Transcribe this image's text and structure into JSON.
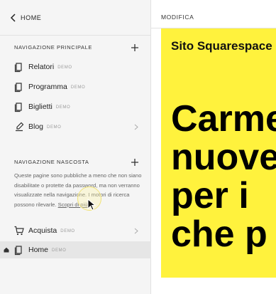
{
  "header": {
    "back_label": "HOME"
  },
  "main_nav": {
    "title": "NAVIGAZIONE PRINCIPALE",
    "items": [
      {
        "label": "Relatori",
        "badge": "DEMO"
      },
      {
        "label": "Programma",
        "badge": "DEMO"
      },
      {
        "label": "Biglietti",
        "badge": "DEMO"
      },
      {
        "label": "Blog",
        "badge": "DEMO"
      }
    ]
  },
  "hidden_nav": {
    "title": "NAVIGAZIONE NASCOSTA",
    "description": "Queste pagine sono pubbliche a meno che non siano disabilitate o protette da password, ma non verranno visualizzate nella navigazione. I motori di ricerca possono rilevarle.",
    "more_link": "Scopri di più",
    "items": [
      {
        "label": "Acquista",
        "badge": "DEMO"
      },
      {
        "label": "Home",
        "badge": "DEMO"
      }
    ]
  },
  "preview": {
    "bar_label": "MODIFICA",
    "site_name": "Sito Squarespace",
    "headline_lines": [
      "Carmen",
      "nuove",
      "per i",
      "che p"
    ]
  },
  "colors": {
    "accent_yellow": "#fff23d",
    "sidebar_bg": "#f5f5f5"
  }
}
